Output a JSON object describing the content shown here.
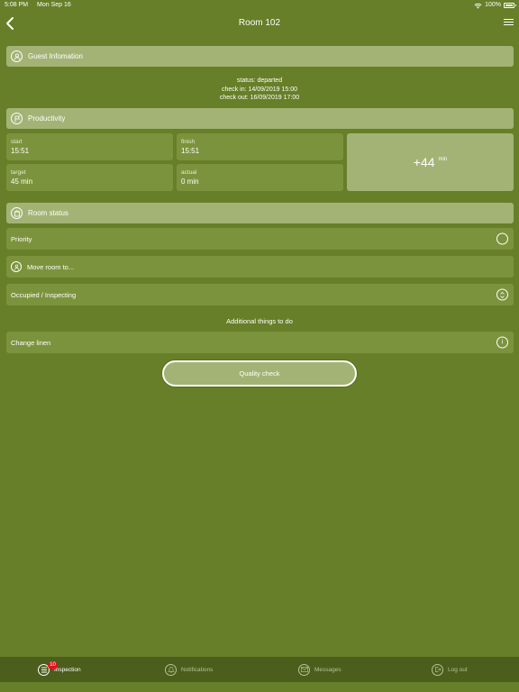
{
  "status_bar": {
    "time": "5:08 PM",
    "date": "Mon Sep 16",
    "battery": "100%"
  },
  "nav": {
    "title": "Room 102"
  },
  "guest_section": {
    "label": "Guest Infomation",
    "status": "status: departed",
    "check_in": "check in: 14/09/2019 15:00",
    "check_out": "check out: 16/09/2019 17:00"
  },
  "productivity": {
    "label": "Productivity",
    "start_label": "start",
    "start_value": "15:51",
    "finish_label": "finish",
    "finish_value": "15:51",
    "target_label": "target",
    "target_value": "45 min",
    "actual_label": "actual",
    "actual_value": "0 min",
    "delta_value": "+44",
    "delta_unit": "min"
  },
  "room_status": {
    "label": "Room status",
    "priority_label": "Priority",
    "move_label": "Move room to...",
    "status_label": "Occupied / Inspecting",
    "additional_label": "Additional things to do",
    "task_label": "Change linen",
    "task_info": "i"
  },
  "quality_check": {
    "label": "Quality check"
  },
  "tabs": {
    "inspection": {
      "label": "Inspection",
      "badge": "10"
    },
    "notifications": {
      "label": "Notifications"
    },
    "messages": {
      "label": "Messages"
    },
    "logout": {
      "label": "Log out"
    }
  },
  "colors": {
    "background": "#667f28",
    "header": "#a3b375",
    "tile": "#7c933d",
    "tabbar": "#4b5e1c",
    "badge": "#e0141e"
  }
}
